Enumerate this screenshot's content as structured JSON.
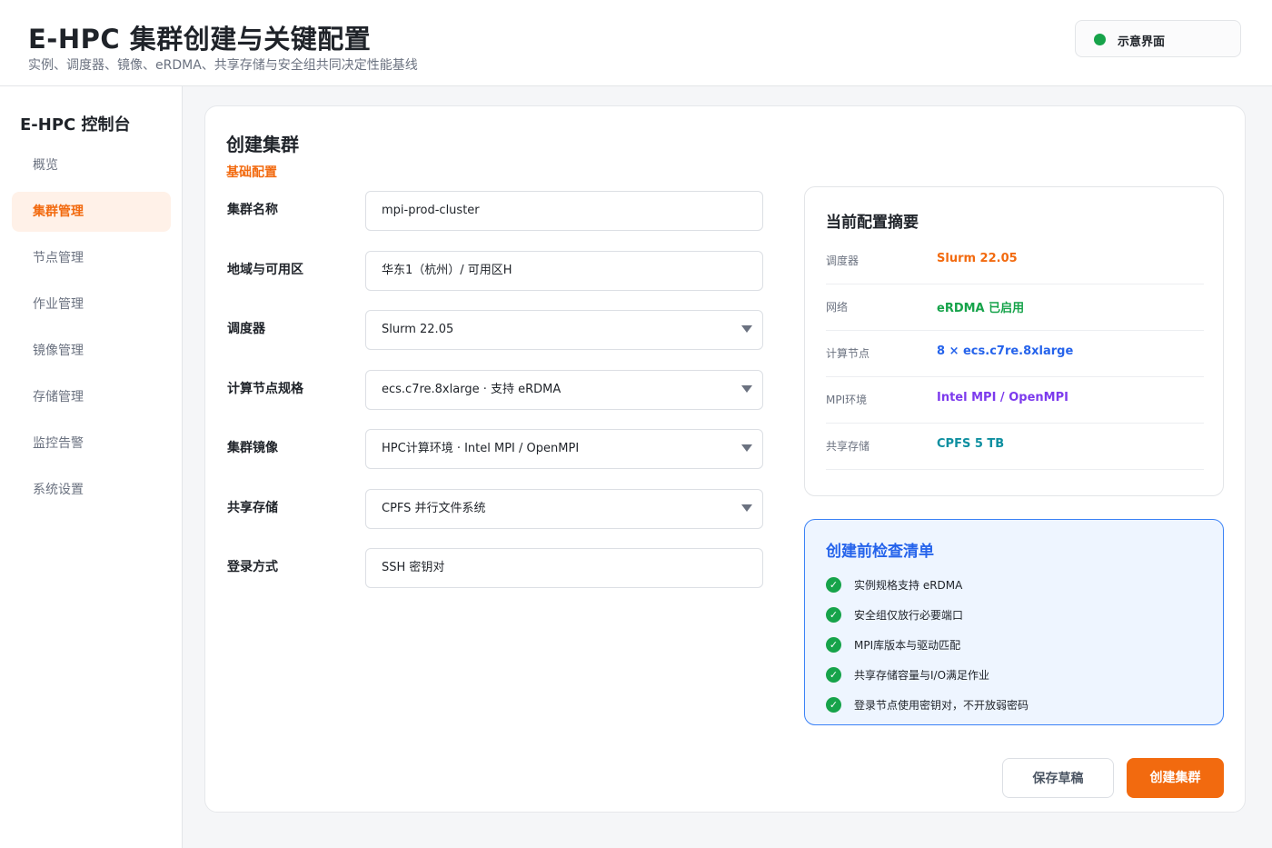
{
  "header": {
    "title": "E-HPC 集群创建与关键配置",
    "subtitle": "实例、调度器、镜像、eRDMA、共享存储与安全组共同决定性能基线",
    "status_label": "示意界面",
    "status_color": "#17a34a"
  },
  "sidebar": {
    "brand": "E-HPC 控制台",
    "items": [
      {
        "label": "概览",
        "active": false
      },
      {
        "label": "集群管理",
        "active": true
      },
      {
        "label": "节点管理",
        "active": false
      },
      {
        "label": "作业管理",
        "active": false
      },
      {
        "label": "镜像管理",
        "active": false
      },
      {
        "label": "存储管理",
        "active": false
      },
      {
        "label": "监控告警",
        "active": false
      },
      {
        "label": "系统设置",
        "active": false
      }
    ]
  },
  "form": {
    "title": "创建集群",
    "section": "基础配置",
    "fields": [
      {
        "label": "集群名称",
        "value": "mpi-prod-cluster",
        "type": "text"
      },
      {
        "label": "地域与可用区",
        "value": "华东1（杭州）/ 可用区H",
        "type": "text"
      },
      {
        "label": "调度器",
        "value": "Slurm 22.05",
        "type": "select"
      },
      {
        "label": "计算节点规格",
        "value": "ecs.c7re.8xlarge · 支持 eRDMA",
        "type": "select"
      },
      {
        "label": "集群镜像",
        "value": "HPC计算环境 · Intel MPI / OpenMPI",
        "type": "select"
      },
      {
        "label": "共享存储",
        "value": "CPFS 并行文件系统",
        "type": "select"
      },
      {
        "label": "登录方式",
        "value": "SSH 密钥对",
        "type": "text"
      }
    ]
  },
  "summary": {
    "title": "当前配置摘要",
    "rows": [
      {
        "key": "调度器",
        "value": "Slurm 22.05",
        "color": "#f26a0f"
      },
      {
        "key": "网络",
        "value": "eRDMA 已启用",
        "color": "#16a34a"
      },
      {
        "key": "计算节点",
        "value": "8 × ecs.c7re.8xlarge",
        "color": "#2563eb"
      },
      {
        "key": "MPI环境",
        "value": "Intel MPI / OpenMPI",
        "color": "#7c3aed"
      },
      {
        "key": "共享存储",
        "value": "CPFS 5 TB",
        "color": "#0e8fa0"
      }
    ]
  },
  "checklist": {
    "title": "创建前检查清单",
    "items": [
      "实例规格支持 eRDMA",
      "安全组仅放行必要端口",
      "MPI库版本与驱动匹配",
      "共享存储容量与I/O满足作业",
      "登录节点使用密钥对，不开放弱密码"
    ]
  },
  "actions": {
    "save_draft": "保存草稿",
    "create": "创建集群"
  },
  "colors": {
    "accent": "#f26a0f",
    "check_border": "#3b82f6"
  }
}
